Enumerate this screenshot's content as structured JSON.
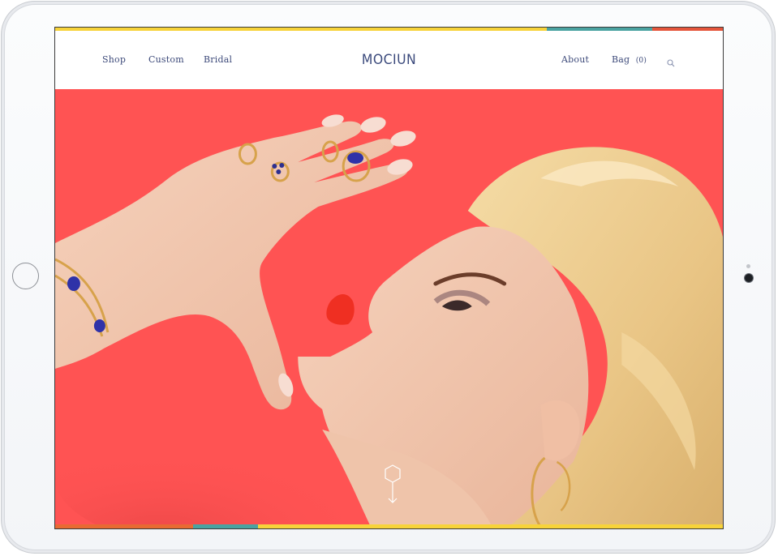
{
  "nav": {
    "left": [
      "Shop",
      "Custom",
      "Bridal"
    ],
    "logo": "MOCIUN",
    "about": "About",
    "bag_label": "Bag",
    "bag_count": "(0)"
  },
  "icons": {
    "search": "search-icon",
    "scroll": "hexagon-arrow-down-icon",
    "home": "home-button-icon"
  },
  "colors": {
    "brand_text": "#3d4a7a",
    "hero_background": "#ff5353",
    "stripe_yellow": "#f7d33a",
    "stripe_teal": "#4aa3a1",
    "stripe_red": "#e5553b",
    "stripe_orange": "#e86a32"
  }
}
